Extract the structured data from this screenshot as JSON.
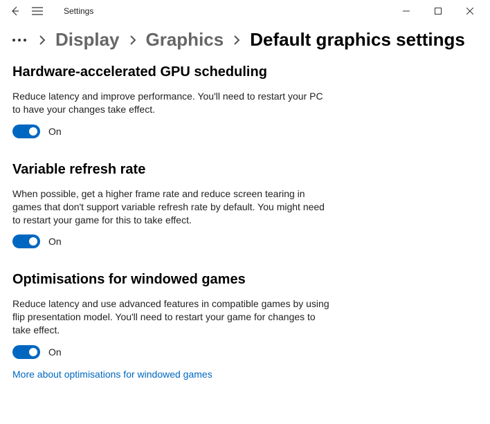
{
  "titlebar": {
    "title": "Settings"
  },
  "breadcrumb": {
    "items": [
      "Display",
      "Graphics"
    ],
    "current": "Default graphics settings"
  },
  "sections": [
    {
      "title": "Hardware-accelerated GPU scheduling",
      "description": "Reduce latency and improve performance. You'll need to restart your PC to have your changes take effect.",
      "toggle_label": "On"
    },
    {
      "title": "Variable refresh rate",
      "description": "When possible, get a higher frame rate and reduce screen tearing in games that don't support variable refresh rate by default. You might need to restart your game for this to take effect.",
      "toggle_label": "On"
    },
    {
      "title": "Optimisations for windowed games",
      "description": "Reduce latency and use advanced features in compatible games by using flip presentation model. You'll need to restart your game for changes to take effect.",
      "toggle_label": "On",
      "link": "More about optimisations for windowed games"
    }
  ]
}
